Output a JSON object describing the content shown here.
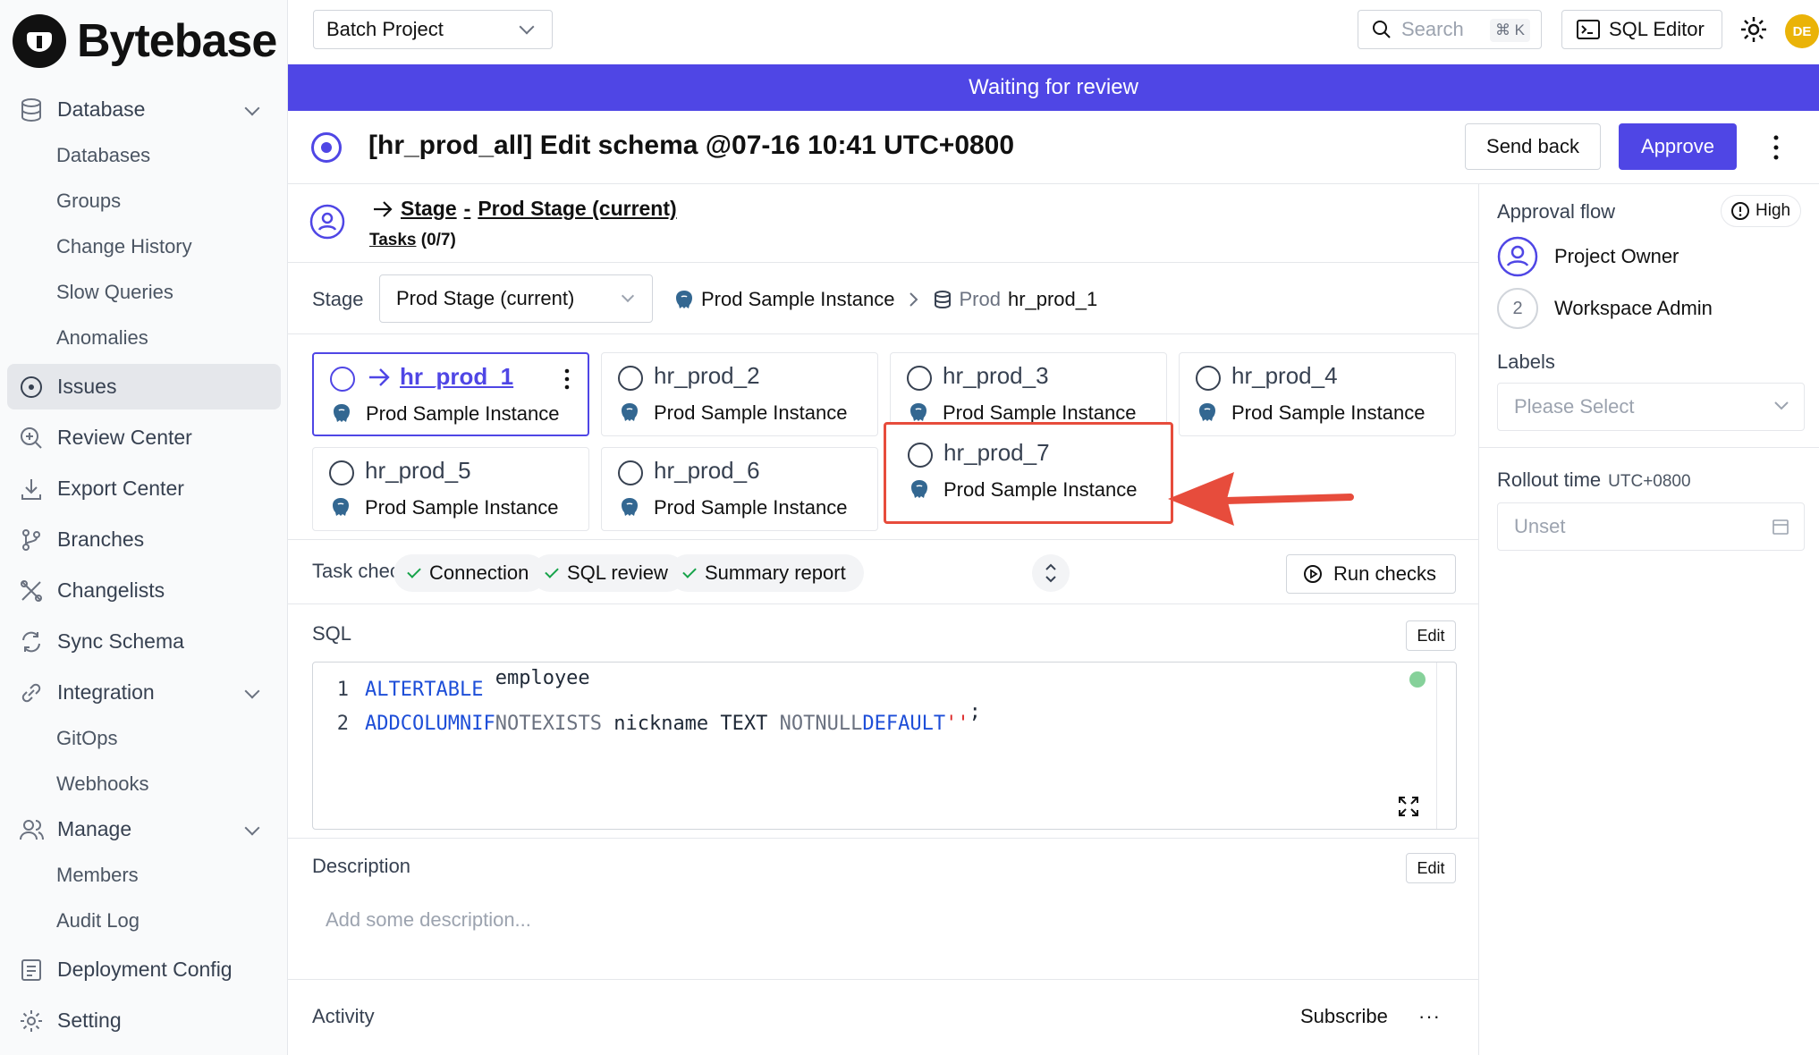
{
  "brand": {
    "name": "Bytebase"
  },
  "sidebar": {
    "database": {
      "label": "Database"
    },
    "database_items": [
      "Databases",
      "Groups",
      "Change History",
      "Slow Queries",
      "Anomalies"
    ],
    "issues": "Issues",
    "review_center": "Review Center",
    "export_center": "Export Center",
    "branches": "Branches",
    "changelists": "Changelists",
    "sync_schema": "Sync Schema",
    "integration": "Integration",
    "integration_items": [
      "GitOps",
      "Webhooks"
    ],
    "manage": "Manage",
    "manage_items": [
      "Members",
      "Audit Log"
    ],
    "deployment_config": "Deployment Config",
    "setting": "Setting"
  },
  "topbar": {
    "project": "Batch Project",
    "search_label": "Search",
    "search_kbd": "⌘ K",
    "sql_editor": "SQL Editor",
    "avatar_initials": "DE"
  },
  "banner": {
    "text": "Waiting for review"
  },
  "issue": {
    "title": "[hr_prod_all] Edit schema @07-16 10:41 UTC+0800",
    "send_back": "Send back",
    "approve": "Approve"
  },
  "stage": {
    "link_stage": "Stage",
    "link_sep": "-",
    "link_name": "Prod Stage (current)",
    "tasks_label": "Tasks",
    "tasks_count": "(0/7)",
    "label": "Stage",
    "selected": "Prod Stage (current)",
    "crumb_instance": "Prod Sample Instance",
    "crumb_env": "Prod",
    "crumb_db": "hr_prod_1"
  },
  "tasks": [
    {
      "name": "hr_prod_1",
      "instance": "Prod Sample Instance"
    },
    {
      "name": "hr_prod_2",
      "instance": "Prod Sample Instance"
    },
    {
      "name": "hr_prod_3",
      "instance": "Prod Sample Instance"
    },
    {
      "name": "hr_prod_4",
      "instance": "Prod Sample Instance"
    },
    {
      "name": "hr_prod_5",
      "instance": "Prod Sample Instance"
    },
    {
      "name": "hr_prod_6",
      "instance": "Prod Sample Instance"
    },
    {
      "name": "hr_prod_7",
      "instance": "Prod Sample Instance"
    }
  ],
  "checks": {
    "label": "Task checks",
    "items": [
      "Connection",
      "SQL review",
      "Summary report"
    ],
    "run": "Run checks"
  },
  "sql": {
    "label": "SQL",
    "edit": "Edit",
    "lines": [
      "1",
      "2"
    ]
  },
  "description": {
    "label": "Description",
    "edit": "Edit",
    "placeholder": "Add some description..."
  },
  "activity": {
    "label": "Activity",
    "subscribe": "Subscribe",
    "more": "···"
  },
  "right": {
    "approval_flow": "Approval flow",
    "risk": "High",
    "approvers": [
      {
        "step": "",
        "name": "Project Owner"
      },
      {
        "step": "2",
        "name": "Workspace Admin"
      }
    ],
    "labels": "Labels",
    "labels_placeholder": "Please Select",
    "rollout_time": "Rollout time",
    "rollout_tz": "UTC+0800",
    "rollout_placeholder": "Unset"
  },
  "colors": {
    "accent": "#4f46e5",
    "annotation": "#e74c3c",
    "success": "#16a34a"
  }
}
